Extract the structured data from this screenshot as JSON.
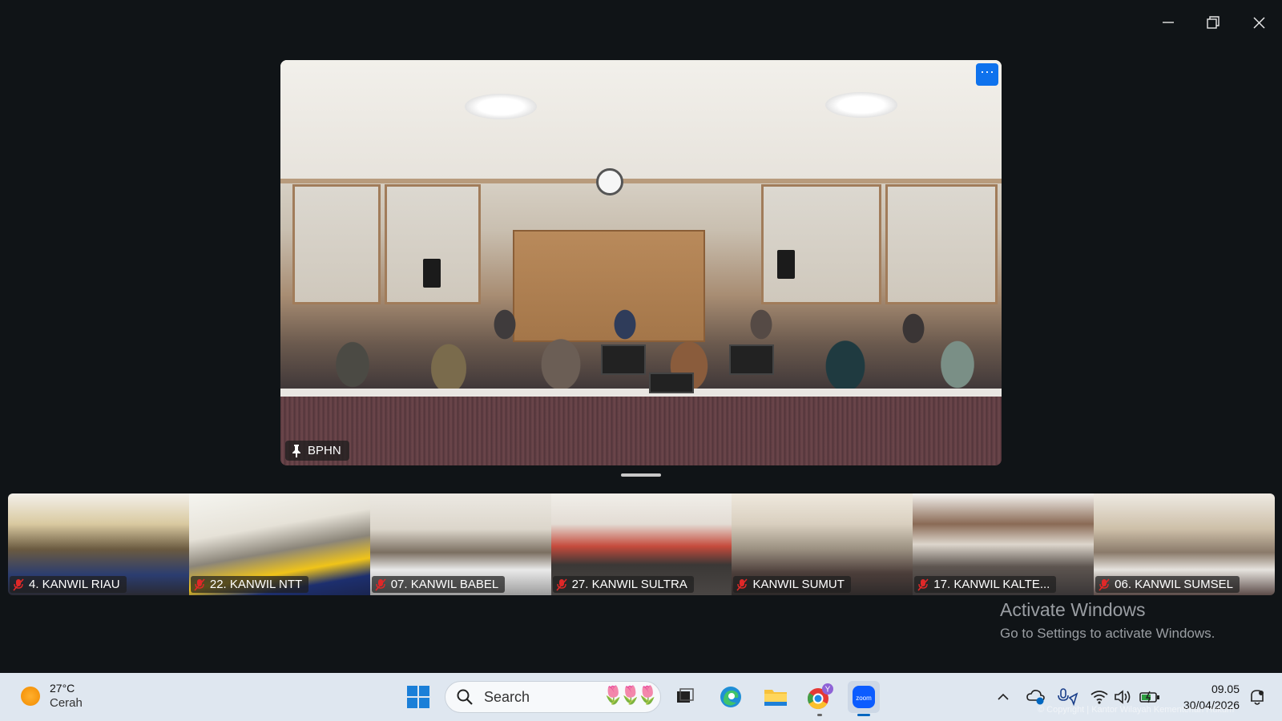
{
  "window": {
    "controls": {
      "minimize": "minimize-icon",
      "restore": "restore-icon",
      "close": "close-icon"
    }
  },
  "main_video": {
    "participant_name": "BPHN",
    "pinned": true,
    "more_button": "···"
  },
  "thumbnails": [
    {
      "label": "4. KANWIL RIAU",
      "muted": true
    },
    {
      "label": "22. KANWIL NTT",
      "muted": true
    },
    {
      "label": "07. KANWIL BABEL",
      "muted": true
    },
    {
      "label": "27. KANWIL SULTRA",
      "muted": true
    },
    {
      "label": "KANWIL SUMUT",
      "muted": true
    },
    {
      "label": "17. KANWIL KALTE...",
      "muted": true
    },
    {
      "label": "06. KANWIL SUMSEL",
      "muted": true
    }
  ],
  "watermark": {
    "title": "Activate Windows",
    "subtitle": "Go to Settings to activate Windows."
  },
  "taskbar": {
    "weather": {
      "temp": "27°C",
      "condition": "Cerah"
    },
    "search": {
      "placeholder": "Search"
    },
    "apps": [
      "windows-start-icon",
      "task-view-icon",
      "edge-icon",
      "file-explorer-icon",
      "chrome-icon",
      "zoom-icon"
    ],
    "clock": {
      "time": "09.05",
      "date": "30/04/2026"
    },
    "copyright": "© Copyright | Kantor Wilayah Kementerian Hukum"
  },
  "colors": {
    "accent": "#0e72ed",
    "background": "#101417",
    "taskbar": "#dfe7f0"
  }
}
